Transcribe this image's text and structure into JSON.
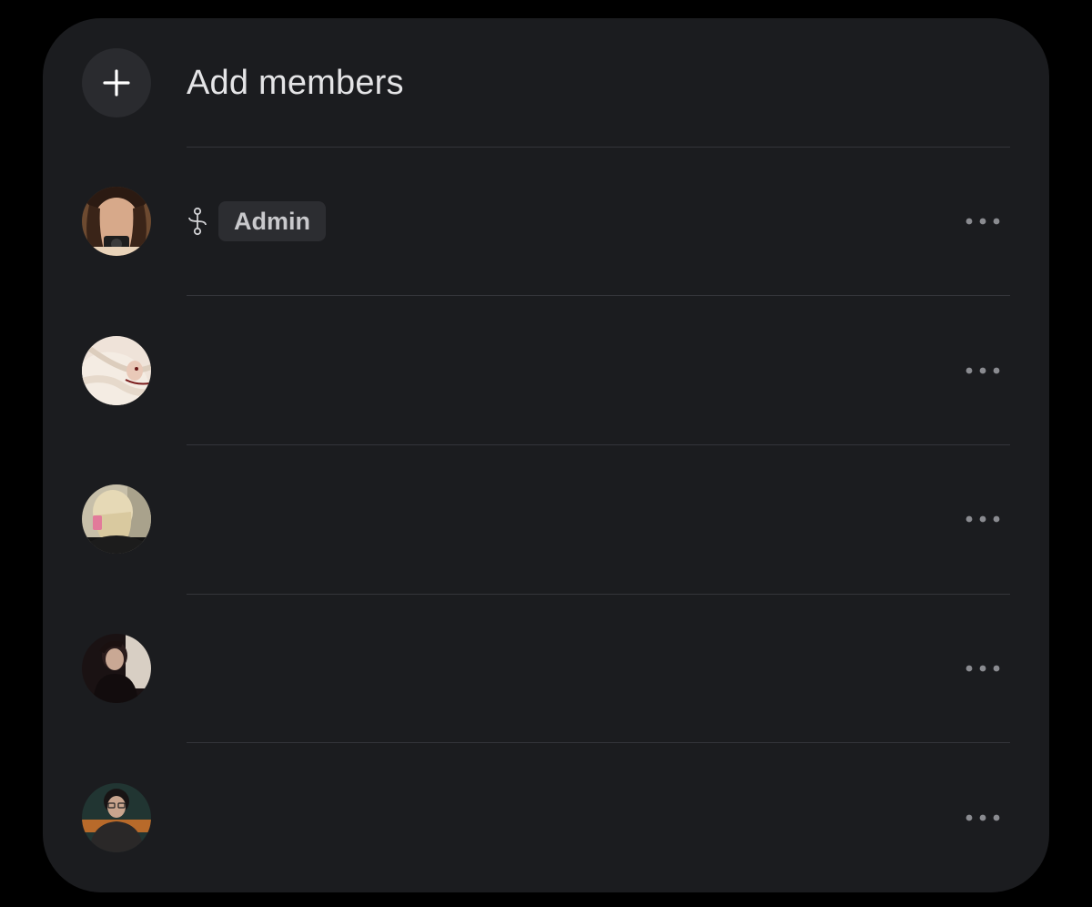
{
  "add_members": {
    "label": "Add members",
    "icon": "plus-icon"
  },
  "members": [
    {
      "avatar": "avatar-photo-camera-selfie",
      "role_icon": "role-link-icon",
      "role_badge": "Admin",
      "more_icon": "more-horizontal-icon"
    },
    {
      "avatar": "avatar-photo-blonde-hair",
      "more_icon": "more-horizontal-icon"
    },
    {
      "avatar": "avatar-photo-blonde-mirror",
      "more_icon": "more-horizontal-icon"
    },
    {
      "avatar": "avatar-photo-dark-portrait",
      "more_icon": "more-horizontal-icon"
    },
    {
      "avatar": "avatar-photo-glasses-portrait",
      "more_icon": "more-horizontal-icon"
    }
  ],
  "colors": {
    "page_background": "#000000",
    "card_background": "#1b1c1f",
    "divider": "#34353a",
    "text_primary": "#e4e4e6",
    "badge_background": "#2c2d31",
    "badge_text": "#c9c9cc",
    "more_dots": "#8a8b90"
  }
}
